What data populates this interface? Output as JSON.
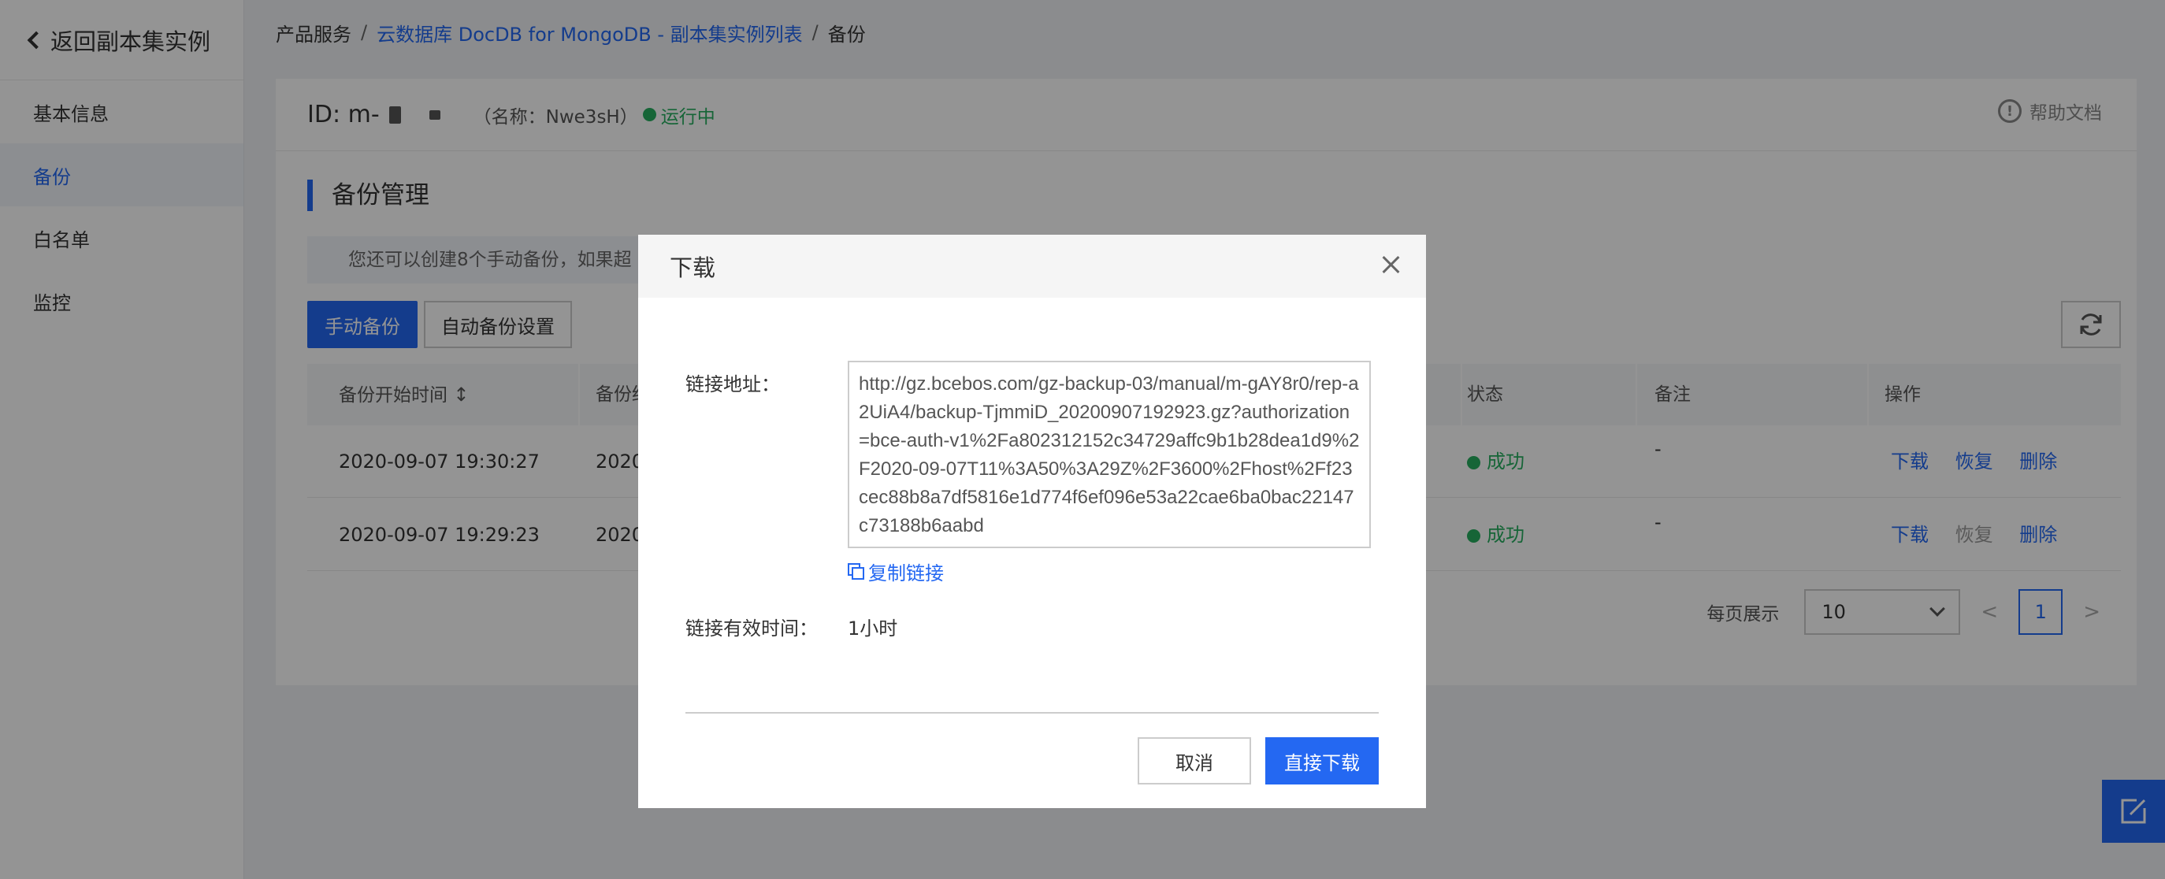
{
  "sidebar": {
    "back_label": "返回副本集实例",
    "items": [
      {
        "label": "基本信息",
        "active": false
      },
      {
        "label": "备份",
        "active": true
      },
      {
        "label": "白名单",
        "active": false
      },
      {
        "label": "监控",
        "active": false
      }
    ]
  },
  "breadcrumb": {
    "items": [
      "产品服务",
      "云数据库 DocDB for MongoDB - 副本集实例列表",
      "备份"
    ],
    "separator": "/"
  },
  "instance": {
    "id_label": "ID: m-",
    "name_text": "（名称：Nwe3sH）",
    "status": "运行中",
    "help": "帮助文档"
  },
  "section": {
    "title": "备份管理",
    "notice": "您还可以创建8个手动备份，如果超"
  },
  "toolbar": {
    "manual_backup": "手动备份",
    "auto_backup_settings": "自动备份设置"
  },
  "table": {
    "columns": [
      "备份开始时间",
      "备份结",
      "状态",
      "备注",
      "操作"
    ],
    "rows": [
      {
        "start": "2020-09-07 19:30:27",
        "end": "2020",
        "status": "成功",
        "note": "-",
        "ops": [
          "下载",
          "恢复",
          "删除"
        ],
        "restore_enabled": true
      },
      {
        "start": "2020-09-07 19:29:23",
        "end": "2020",
        "status": "成功",
        "note": "-",
        "ops": [
          "下载",
          "恢复",
          "删除"
        ],
        "restore_enabled": false
      }
    ]
  },
  "pager": {
    "per_page_label": "每页展示",
    "per_page": "10",
    "prev": "<",
    "next": ">",
    "current": "1"
  },
  "modal": {
    "title": "下载",
    "link_label": "链接地址：",
    "link_url": "http://gz.bcebos.com/gz-backup-03/manual/m-gAY8r0/rep-a2UiA4/backup-TjmmiD_20200907192923.gz?authorization=bce-auth-v1%2Fa802312152c34729affc9b1b28dea1d9%2F2020-09-07T11%3A50%3A29Z%2F3600%2Fhost%2Ff23cec88b8a7df5816e1d774f6ef096e53a22cae6ba0bac22147c73188b6aabd",
    "copy_label": "复制链接",
    "valid_label": "链接有效时间：",
    "valid_value": "1小时",
    "cancel": "取消",
    "download": "直接下载"
  },
  "colors": {
    "primary": "#2468f2",
    "success": "#27ae60"
  }
}
